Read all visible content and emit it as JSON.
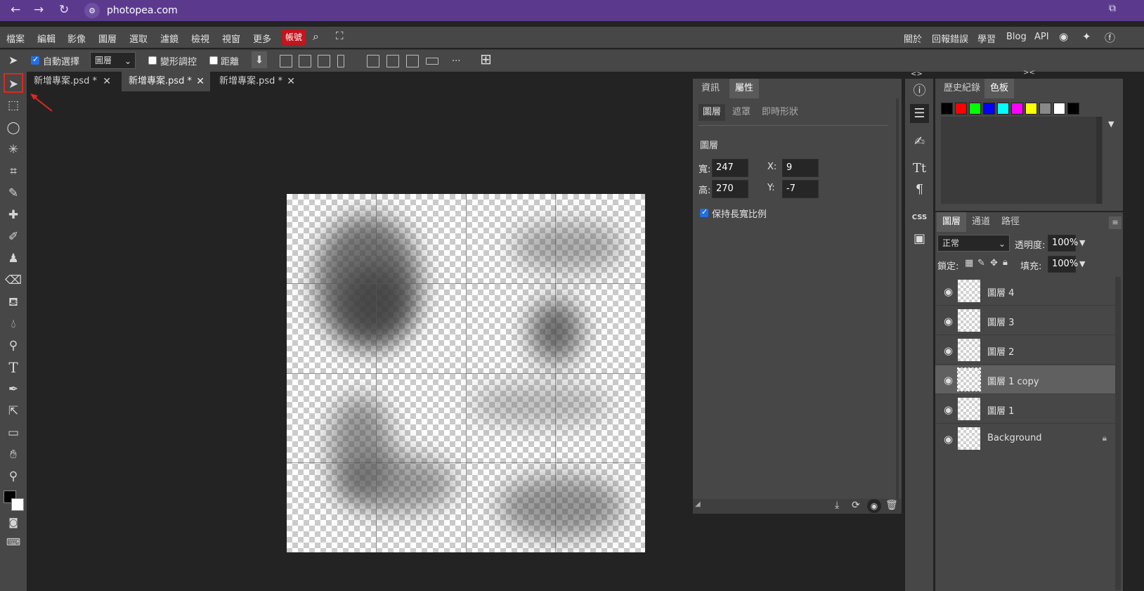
{
  "browser": {
    "url": "photopea.com",
    "back": "←",
    "forward": "→",
    "reload": "↻"
  },
  "menubar": {
    "items": [
      "檔案",
      "編輯",
      "影像",
      "圖層",
      "選取",
      "濾鏡",
      "檢視",
      "視窗",
      "更多"
    ],
    "account": "帳號",
    "right_items": [
      "關於",
      "回報錯誤",
      "學習",
      "Blog",
      "API"
    ]
  },
  "options": {
    "auto_select_label": "自動選擇",
    "auto_select_checked": true,
    "auto_select_value": "圖層",
    "transform_label": "變形調控",
    "distance_label": "距離",
    "more": "..."
  },
  "doc_tabs": [
    {
      "label": "新增專案.psd *",
      "close": "✕"
    },
    {
      "label": "新增專案.psd *",
      "close": "✕"
    },
    {
      "label": "新增專案.psd *",
      "close": "✕"
    }
  ],
  "props": {
    "tabs": [
      "資訊",
      "屬性"
    ],
    "subtabs": [
      "圖層",
      "遮罩",
      "即時形狀"
    ],
    "section_title": "圖層",
    "width_label": "寬:",
    "width": "247",
    "height_label": "高:",
    "height": "270",
    "x_label": "X:",
    "x": "9",
    "y_label": "Y:",
    "y": "-7",
    "keep_ratio_label": "保持長寬比例"
  },
  "history": {
    "tabs": [
      "歷史紀錄",
      "色板"
    ],
    "swatches": [
      "#000000",
      "#ff0000",
      "#00ff00",
      "#0000ff",
      "#00ffff",
      "#ff00ff",
      "#ffff00",
      "#888888",
      "#ffffff",
      "#000000"
    ]
  },
  "layers": {
    "tabs": [
      "圖層",
      "通道",
      "路徑"
    ],
    "blend_mode": "正常",
    "opacity_label": "透明度:",
    "opacity": "100%",
    "lock_label": "鎖定:",
    "fill_label": "填充:",
    "fill": "100%",
    "items": [
      {
        "name": "圖層 4",
        "selected": false,
        "locked": false
      },
      {
        "name": "圖層 3",
        "selected": false,
        "locked": false
      },
      {
        "name": "圖層 2",
        "selected": false,
        "locked": false
      },
      {
        "name": "圖層 1 copy",
        "selected": true,
        "locked": false
      },
      {
        "name": "圖層 1",
        "selected": false,
        "locked": false
      },
      {
        "name": "Background",
        "selected": false,
        "locked": true
      }
    ]
  },
  "icon_strip": {
    "css_label": "CSS"
  },
  "colors": {
    "browser": "#5b3a8e",
    "panel": "#474747",
    "workspace": "#232323",
    "account_red": "#c4141c"
  }
}
